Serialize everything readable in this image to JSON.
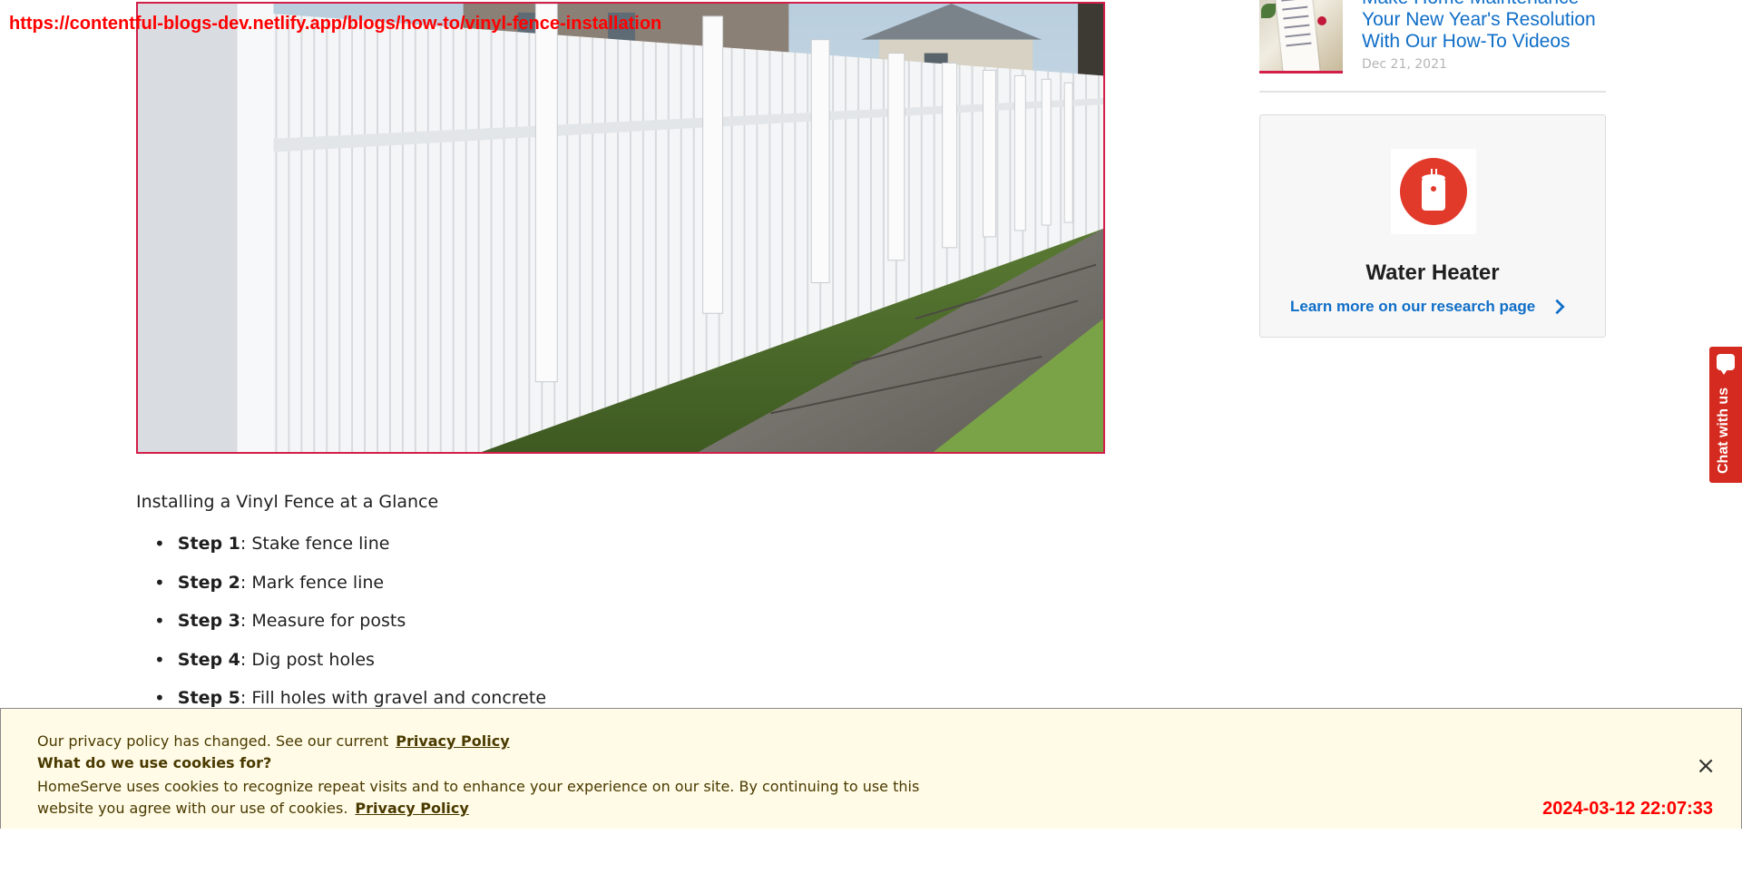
{
  "overlay": {
    "url": "https://contentful-blogs-dev.netlify.app/blogs/how-to/vinyl-fence-installation",
    "timestamp": "2024-03-12 22:07:33"
  },
  "article": {
    "glance_title": "Installing a Vinyl Fence at a Glance",
    "steps": [
      {
        "label": "Step 1",
        "text": ": Stake fence line"
      },
      {
        "label": "Step 2",
        "text": ": Mark fence line"
      },
      {
        "label": "Step 3",
        "text": ": Measure for posts"
      },
      {
        "label": "Step 4",
        "text": ": Dig post holes"
      },
      {
        "label": "Step 5",
        "text": ": Fill holes with gravel and concrete"
      }
    ]
  },
  "sidebar": {
    "related": {
      "title": "Make Home Maintenance Your New Year's Resolution With Our How-To Videos",
      "date": "Dec 21, 2021"
    },
    "card": {
      "title": "Water Heater",
      "link": "Learn more on our research page"
    }
  },
  "chat": {
    "label": "Chat with us"
  },
  "cookie": {
    "line1": "Our privacy policy has changed. See our current",
    "link1": "Privacy Policy",
    "line2": "What do we use cookies for?",
    "line3": "HomeServe uses cookies to recognize repeat visits and to enhance your experience on our site. By continuing to use this website you agree with our use of cookies.",
    "link2": "Privacy Policy",
    "close": "×"
  },
  "colors": {
    "accent_red": "#d21e48",
    "link_blue": "#0f6ec8",
    "cookie_bg": "#fffbe6",
    "overlay_red": "#ff0000"
  }
}
